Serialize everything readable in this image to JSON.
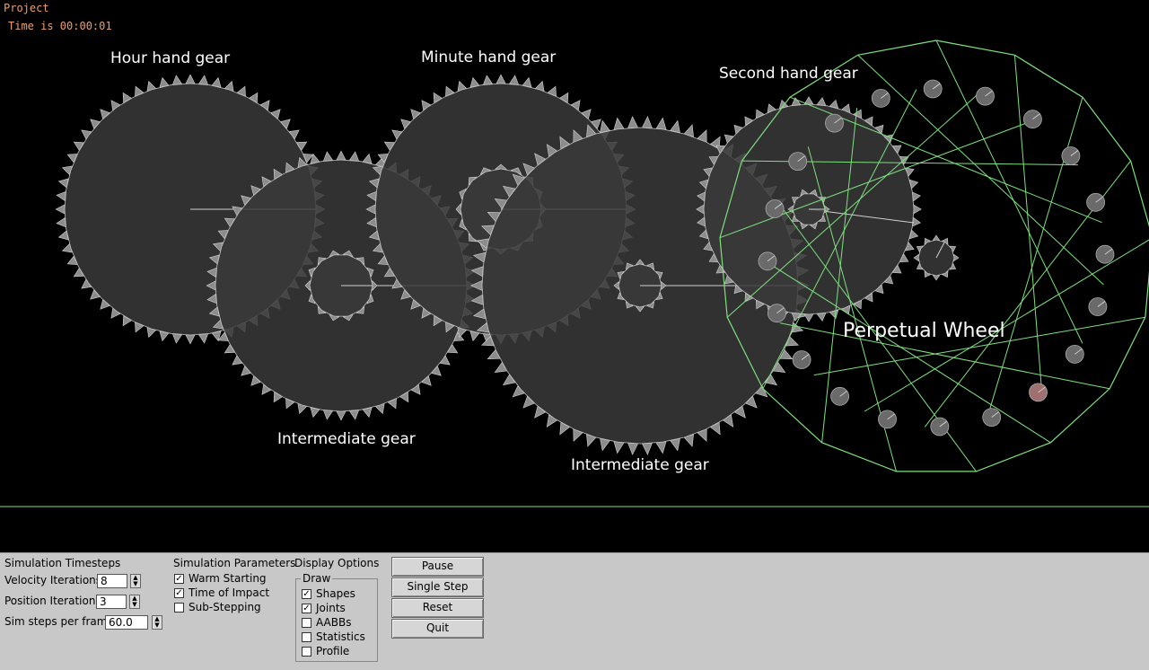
{
  "window": {
    "title": "Project",
    "time_text": "Time is 00:00:01"
  },
  "scene": {
    "labels": {
      "hour": "Hour hand gear",
      "minute": "Minute hand gear",
      "second": "Second hand gear",
      "intermediate1": "Intermediate gear",
      "intermediate2": "Intermediate gear",
      "wheel": "Perpetual Wheel"
    },
    "colors": {
      "gear_fill": "#3a3a3a",
      "gear_stroke": "#bdbdbd",
      "wheel_line": "#7ee07e",
      "ball": "#6a6a6a",
      "ball_highlight": "#a07070"
    }
  },
  "panel": {
    "timesteps": {
      "title": "Simulation Timesteps",
      "velocity_label": "Velocity Iterations",
      "velocity_value": "8",
      "position_label": "Position Iterations",
      "position_value": "3",
      "sim_steps_label": "Sim steps per frame",
      "sim_steps_value": "60.0"
    },
    "params": {
      "title": "Simulation Parameters",
      "warm_starting": "Warm Starting",
      "warm_starting_checked": true,
      "time_of_impact": "Time of Impact",
      "time_of_impact_checked": true,
      "sub_stepping": "Sub-Stepping",
      "sub_stepping_checked": false
    },
    "display": {
      "title": "Display Options",
      "draw_label": "Draw",
      "shapes": "Shapes",
      "shapes_checked": true,
      "joints": "Joints",
      "joints_checked": true,
      "aabbs": "AABBs",
      "aabbs_checked": false,
      "statistics": "Statistics",
      "statistics_checked": false,
      "profile": "Profile",
      "profile_checked": false
    },
    "buttons": {
      "pause": "Pause",
      "single_step": "Single Step",
      "reset": "Reset",
      "quit": "Quit"
    }
  }
}
